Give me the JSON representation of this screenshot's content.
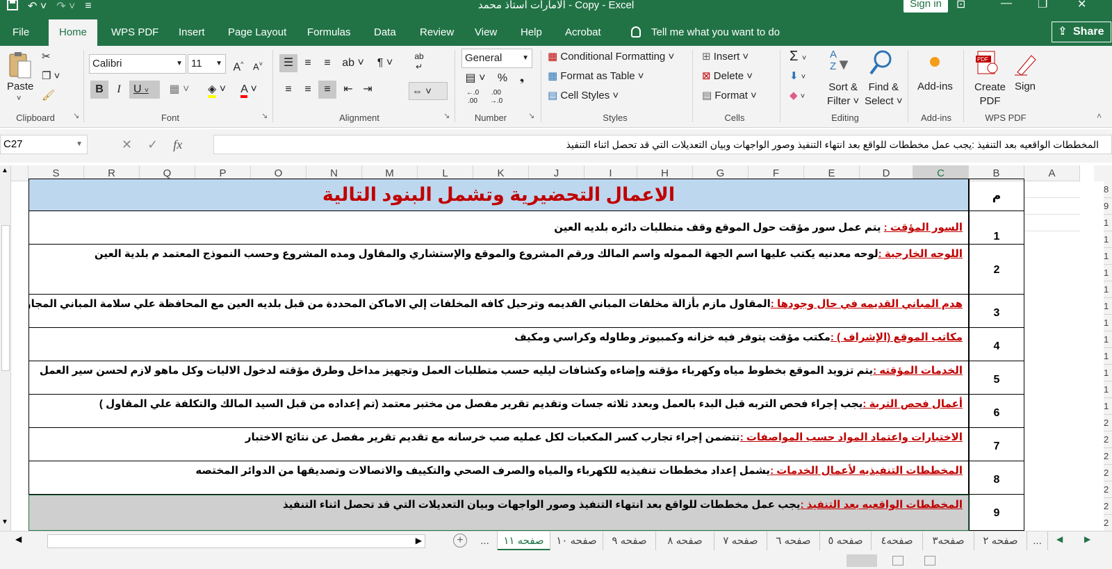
{
  "window": {
    "title": "الامارات استاذ محمد - Copy  -  Excel",
    "signin_label": "Sign in",
    "qat_icons": [
      "save-icon",
      "undo-icon",
      "redo-icon",
      "customize-qat-icon"
    ]
  },
  "menu": {
    "tabs": [
      "File",
      "Home",
      "WPS PDF",
      "Insert",
      "Page Layout",
      "Formulas",
      "Data",
      "Review",
      "View",
      "Help",
      "Acrobat"
    ],
    "active_tab": "Home",
    "tell_me": "Tell me what you want to do",
    "share_label": "Share"
  },
  "ribbon": {
    "clipboard": {
      "paste_label": "Paste",
      "group_label": "Clipboard"
    },
    "font": {
      "name": "Calibri",
      "size": "11",
      "bold": "B",
      "italic": "I",
      "underline": "U",
      "group_label": "Font"
    },
    "alignment": {
      "group_label": "Alignment"
    },
    "number": {
      "format": "General",
      "percent": "%",
      "comma": "❟",
      "inc_decimal": "←.0 .00",
      "dec_decimal": ".00 →.0",
      "group_label": "Number"
    },
    "styles": {
      "conditional": "Conditional Formatting",
      "format_table": "Format as Table",
      "cell_styles": "Cell Styles",
      "group_label": "Styles"
    },
    "cells": {
      "insert": "Insert",
      "delete": "Delete",
      "format": "Format",
      "group_label": "Cells"
    },
    "editing": {
      "sort_filter_1": "Sort &",
      "sort_filter_2": "Filter",
      "find_select_1": "Find &",
      "find_select_2": "Select",
      "group_label": "Editing"
    },
    "addins": {
      "label": "Add-ins",
      "group_label": "Add-ins"
    },
    "wps_pdf": {
      "create_1": "Create",
      "create_2": "PDF",
      "sign": "Sign",
      "group_label": "WPS PDF"
    }
  },
  "formula_bar": {
    "name_box": "C27",
    "fx": "fx",
    "content": "المخططات الواقعيه بعد التنفيذ :يجب عمل مخططات للواقع بعد انتهاء التنفيذ وصور الواجهات وبيان التعديلات التي قد  تحصل اثناء التنفيذ"
  },
  "columns": [
    "S",
    "R",
    "Q",
    "P",
    "O",
    "N",
    "M",
    "L",
    "K",
    "J",
    "I",
    "H",
    "G",
    "F",
    "E",
    "D",
    "C",
    "B",
    "A"
  ],
  "row_numbers": [
    "8",
    "9",
    "1",
    "1",
    "1",
    "1",
    "1",
    "1",
    "1",
    "1",
    "1",
    "1",
    "1",
    "1",
    "2",
    "2",
    "2",
    "2",
    "2",
    "2",
    "2",
    "2"
  ],
  "sheet": {
    "heading": "الاعمال التحضيرية وتشمل البنود التالية",
    "num_header": "م",
    "items": [
      {
        "num": "1",
        "label": "السور المؤقت :",
        "text": " يتم عمل سور مؤقت حول الموقع وقف متطلبات دائره بلديه العين"
      },
      {
        "num": "2",
        "label": "اللوحه الخارجية :",
        "text": "لوحه معدنيه يكتب عليها اسم الجهة المموله واسم المالك ورقم المشروع والموقع والإستشاري والمقاول ومده المشروع وحسب النموذج المعتمد م بلدية العين"
      },
      {
        "num": "3",
        "label": "هدم المباني القديمه في حال وجودها :",
        "text": "المقاول مازم بأزالة مخلفات المباني القديمه وترحيل كافه المخلفات إلي الاماكن المحددة من قبل بلديه العين مع المحافظة علي سلامة المباني المجاورة"
      },
      {
        "num": "4",
        "label": "مكاتب الموقع (الإشراف ) :",
        "text": "مكتب مؤقت يتوفر فيه خزانه وكمبيوتر وطاوله  وكراسي ومكيف"
      },
      {
        "num": "5",
        "label": "الخدمات المؤقته :",
        "text": "يتم تزويد الموقع بخطوط مياه وكهرباء مؤقته وإضاءه وكشافات ليليه حسب متطلبات العمل وتجهيز مداخل وطرق مؤقته لدخول الاليات وكل ماهو لازم لحسن سير العمل"
      },
      {
        "num": "6",
        "label": "أعمال فحص التربة :",
        "text": "يجب إجراء فحص التربه قبل البدء بالعمل وبعدد ثلاثه جسات وتقديم تقرير مفصل من مختبر معتمد (تم إعداده من قبل السيد المالك والتكلفة علي المقاول )"
      },
      {
        "num": "7",
        "label": "الاختبارات واعتماد المواد حسب المواصفات :",
        "text": "تتضمن إجراء تجارب كسر المكعبات لكل عمليه صب خرسانه مع تقديم تقرير مفصل عن نتائج الاختبار"
      },
      {
        "num": "8",
        "label": "المخططات التنفيذيه لأعمال الخدمات :",
        "text": "يشمل إعداد مخططات تنفيذيه للكهرباء والمياه والصرف الصحي والتكييف والاتصالات وتصديقها من الدوائر المختصه"
      },
      {
        "num": "9",
        "label": "المخططات الواقعيه بعد التنفيذ :",
        "text": "يجب عمل مخططات للواقع بعد انتهاء التنفيذ وصور الواجهات وبيان التعديلات التي قد  تحصل اثناء التنفيذ"
      }
    ]
  },
  "sheet_tabs": [
    "...",
    "صفحه ١١",
    "صفحه ١٠",
    "صفحه ٩",
    "صفحه ٨",
    "صفحه ٧",
    "صفحه ٦",
    "صفحه ٥",
    "صفحه٤",
    "صفحه٣",
    "صفحه ٢",
    "..."
  ],
  "active_sheet": "صفحه ١١",
  "colors": {
    "excel_green": "#217346",
    "heading_fill": "#bdd7ee",
    "label_red": "#c00000",
    "selected_row": "#cfcfcf"
  }
}
